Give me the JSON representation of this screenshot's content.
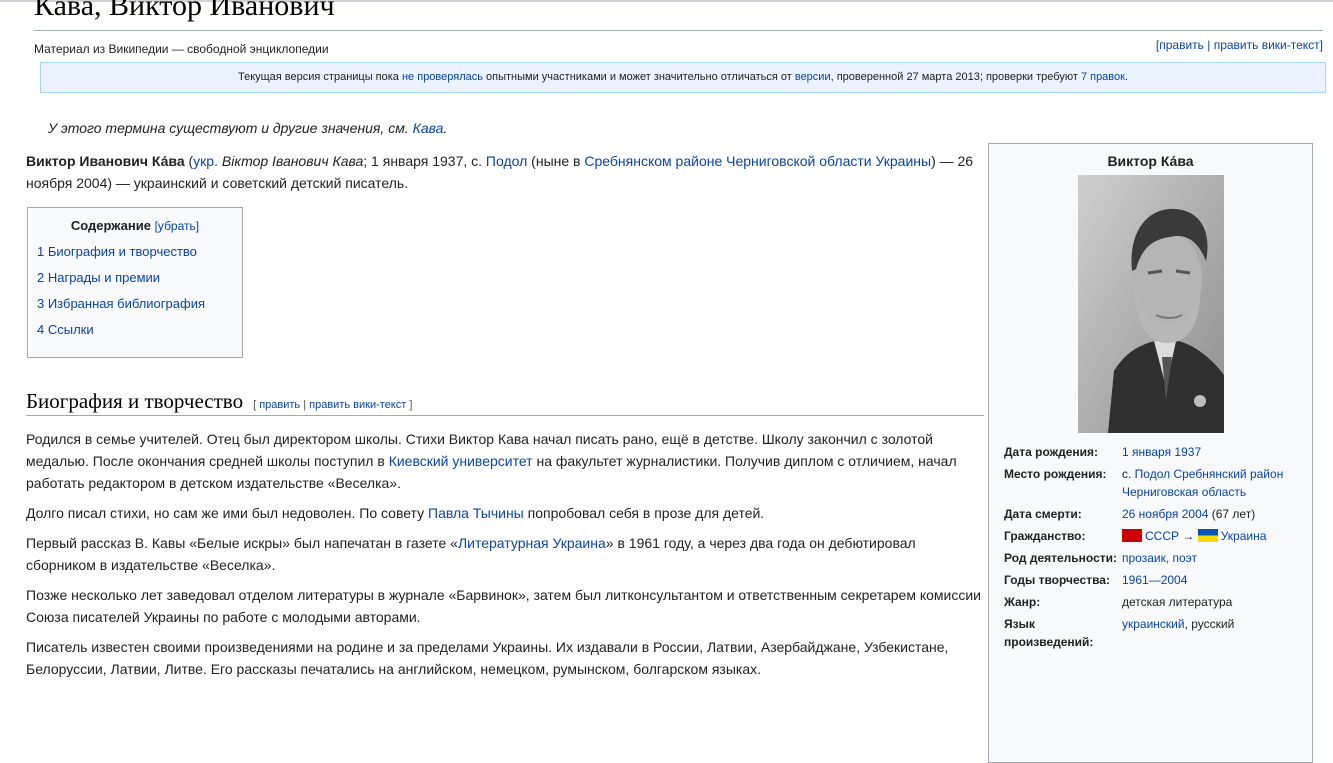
{
  "page": {
    "title": "Кава, Виктор Иванович",
    "tagline": "Материал из Википедии — свободной энциклопедии",
    "edit_links": "[править | править вики-текст]"
  },
  "notice": {
    "t1": "Текущая версия страницы пока ",
    "l1": "не проверялась",
    "t2": " опытными участниками и может значительно отличаться от ",
    "l2": "версии",
    "t3": ", проверенной 27 марта 2013; проверки требуют ",
    "l3": "7 правок",
    "t4": "."
  },
  "hatnote": {
    "text": "У этого термина существуют и другие значения, см. ",
    "link": "Кава",
    "end": "."
  },
  "intro": {
    "name": "Виктор Иванович Ка́ва",
    "t1": " (",
    "l1": "укр.",
    "t2": " Віктор Іванович Кава",
    "t3": "; 1 января 1937, с. ",
    "l2": "Подол",
    "t4": " (ныне в ",
    "l3": "Сребнянском районе Черниговской области Украины",
    "t5": ") — 26 ноября 2004) — украинский и советский детский писатель."
  },
  "toc": {
    "title": "Содержание",
    "toggle": "[убрать]",
    "items": [
      "1 Биография и творчество",
      "2 Награды и премии",
      "3 Избранная библиография",
      "4 Ссылки"
    ]
  },
  "section": {
    "heading": "Биография и творчество",
    "edit_open": "[ ",
    "edit_1": "править",
    "edit_sep": " | ",
    "edit_2": "править вики-текст",
    "edit_close": " ]"
  },
  "bio": {
    "p1a": "Родился в семье учителей. Отец был директором школы. Стихи Виктор Кава начал писать рано, ещё в детстве. Школу закончил с золотой медалью. После окончания средней школы поступил в ",
    "p1l": "Киевский университет",
    "p1b": " на факультет журналистики. Получив диплом с отличием, начал работать редактором в детском издательстве «Веселка».",
    "p2a": "Долго писал стихи, но сам же ими был недоволен. По совету ",
    "p2l": "Павла Тычины",
    "p2b": " попробовал себя в прозе для детей.",
    "p3a": "Первый рассказ В. Кавы «Белые искры» был напечатан в газете «",
    "p3l": "Литературная Украина",
    "p3b": "» в 1961 году, а через два года он дебютировал сборником в издательстве «Веселка».",
    "p4": "Позже несколько лет заведовал отделом литературы в журнале «Барвинок», затем был литконсультантом и ответственным секретарем комиссии Союза писателей Украины по работе с молодыми авторами.",
    "p5": "Писатель известен своими произведениями на родине и за пределами Украины. Их издавали в России, Латвии, Азербайджане, Узбекистане, Белоруссии, Латвии, Литве. Его рассказы печатались на английском, немецком, румынском, болгарском языках."
  },
  "infobox": {
    "title": "Виктор Ка́ва",
    "rows": {
      "birth_date": {
        "label": "Дата рождения:",
        "value": "1 января 1937"
      },
      "birth_place": {
        "label": "Место рождения:",
        "v1": "с. ",
        "l1": "Подол",
        "l2": "Сребнянский район",
        "l3": "Черниговская область"
      },
      "death_date": {
        "label": "Дата смерти:",
        "link": "26 ноября 2004",
        "extra": " (67 лет)"
      },
      "citizenship": {
        "label": "Гражданство:",
        "l1": "СССР",
        "arrow": " → ",
        "l2": "Украина"
      },
      "occupation": {
        "label": "Род деятельности:",
        "value": "прозаик, поэт"
      },
      "years": {
        "label": "Годы творчества:",
        "value": "1961—2004"
      },
      "genre": {
        "label": "Жанр:",
        "value": "детская литература"
      },
      "language": {
        "label": "Язык произведений:",
        "link": "украинский",
        "rest": ", русский"
      }
    }
  },
  "colors": {
    "link": "#0645ad",
    "notice_bg": "#eaf3ff",
    "notice_border": "#a7d7f9",
    "box_bg": "#f8f9fa",
    "border": "#a2a9b1"
  }
}
